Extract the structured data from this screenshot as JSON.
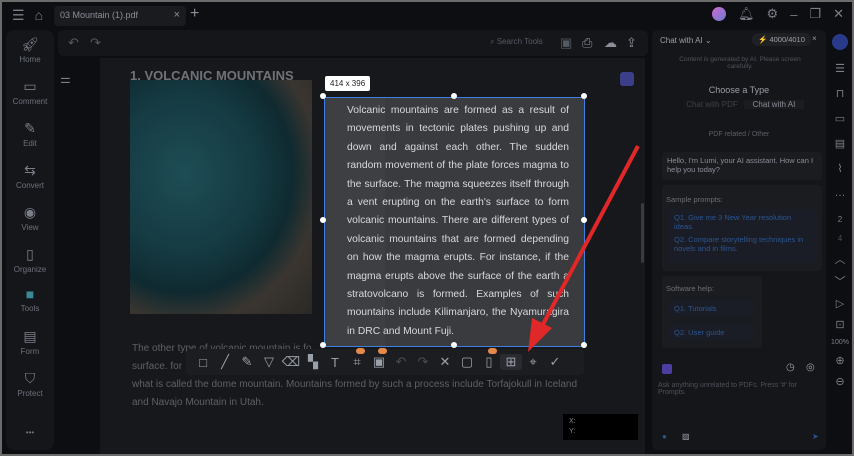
{
  "titlebar": {
    "tab": "03 Mountain (1).pdf"
  },
  "toolbar": {
    "search": "Search Tools"
  },
  "sidebar": [
    "Home",
    "Comment",
    "Edit",
    "Convert",
    "View",
    "Organize",
    "Tools",
    "Form",
    "Protect"
  ],
  "doc": {
    "heading": "1. VOLCANIC MOUNTAINS",
    "selection_size": "414 x 396",
    "selected_text": "Volcanic mountains are formed as a result of movements in tectonic plates pushing up and down and against each other. The sudden random movement of the plate forces magma to the surface. The magma squeezes itself through a vent erupting on the earth's surface to form volcanic mountains. There are different types of volcanic mountains that are formed depending on how the magma erupts. For instance, if the magma erupts above the surface of the earth a stratovolcano is formed. Examples of such mountains include Kilimanjaro, the Nyamuragira in DRC and Mount Fuji.",
    "para_line1": "The other type of volcanic mountain is fo",
    "para_line2": "surface. for",
    "para_line3": "what is called the dome mountain. Mountains formed by such a process include Torfajokull in Iceland",
    "para_line4": "and Navajo Mountain in Utah.",
    "coord_x": "X:",
    "coord_y": "Y:"
  },
  "ai": {
    "mode": "Chat with AI",
    "credits": "4000/4010",
    "notice": "Content is generated by AI. Please screen carefully.",
    "choose": "Choose a Type",
    "opt1": "Chat with PDF",
    "opt2": "Chat with AI",
    "opt_sub": "PDF related / Other",
    "greeting": "Hello, I'm Lumi, your AI assistant. How can I help you today?",
    "sample_title": "Sample prompts:",
    "samples": [
      "Q1. Give me 3 New Year resolution ideas.",
      "Q2. Compare storytelling techniques in novels and in films."
    ],
    "help_title": "Software help:",
    "help": [
      "Q1. Tutorials",
      "Q2. User guide"
    ],
    "input_placeholder": "Ask anything unrelated to PDFs. Press '#' for Prompts."
  },
  "rightbar": {
    "page_a": "2",
    "page_b": "4",
    "zoom": "100%"
  },
  "colors": {
    "accent": "#3f7fe0",
    "arrow": "#e02828"
  }
}
